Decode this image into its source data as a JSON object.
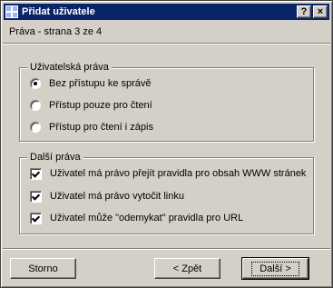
{
  "window": {
    "title": "Přidat uživatele",
    "help_button": "?",
    "close_button": "×"
  },
  "page": {
    "subtitle": "Práva - strana 3 ze 4"
  },
  "user_rights": {
    "legend": "Uživatelská práva",
    "options": [
      {
        "label": "Bez přístupu ke správě",
        "checked": true
      },
      {
        "label": "Přístup pouze pro čtení",
        "checked": false
      },
      {
        "label": "Přístup pro čtení i zápis",
        "checked": false
      }
    ]
  },
  "other_rights": {
    "legend": "Další práva",
    "options": [
      {
        "label": "Uživatel má právo přejít pravidla pro obsah WWW stránek",
        "checked": true
      },
      {
        "label": "Uživatel má právo vytočit linku",
        "checked": true
      },
      {
        "label": "Uživatel může \"odemykat\" pravidla pro URL",
        "checked": true
      }
    ]
  },
  "buttons": {
    "cancel": "Storno",
    "back": "< Zpět",
    "next": "Další >"
  }
}
